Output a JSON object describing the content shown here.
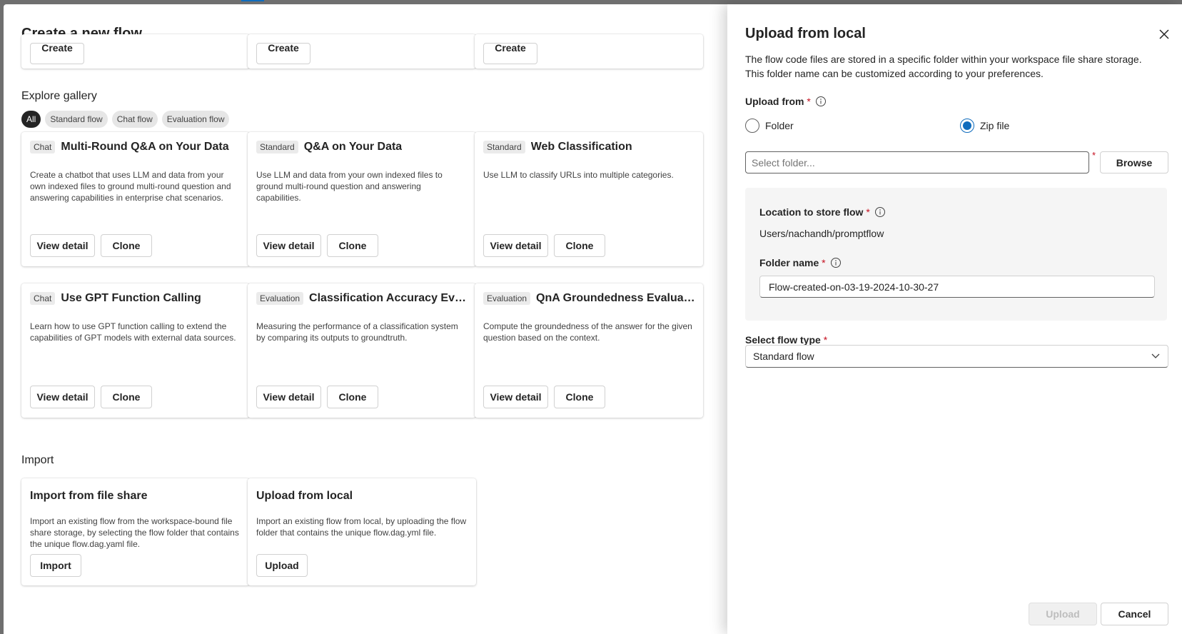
{
  "dialog": {
    "title": "Create a new flow",
    "top_row_buttons": [
      "Create",
      "Create",
      "Create"
    ]
  },
  "gallery": {
    "title": "Explore gallery",
    "filters": [
      "All",
      "Standard flow",
      "Chat flow",
      "Evaluation flow"
    ],
    "active_filter": "All",
    "cards": [
      {
        "tag": "Chat",
        "name": "Multi-Round Q&A on Your Data",
        "desc": "Create a chatbot that uses LLM and data from your own indexed files to ground multi-round question and answering capabilities in enterprise chat scenarios.",
        "view": "View detail",
        "clone": "Clone"
      },
      {
        "tag": "Standard",
        "name": "Q&A on Your Data",
        "desc": "Use LLM and data from your own indexed files to ground multi-round question and answering capabilities.",
        "view": "View detail",
        "clone": "Clone"
      },
      {
        "tag": "Standard",
        "name": "Web Classification",
        "desc": "Use LLM to classify URLs into multiple categories.",
        "view": "View detail",
        "clone": "Clone"
      },
      {
        "tag": "Chat",
        "name": "Use GPT Function Calling",
        "desc": "Learn how to use GPT function calling to extend the capabilities of GPT models with external data sources.",
        "view": "View detail",
        "clone": "Clone"
      },
      {
        "tag": "Evaluation",
        "name": "Classification Accuracy Evalu...",
        "desc": "Measuring the performance of a classification system by comparing its outputs to groundtruth.",
        "view": "View detail",
        "clone": "Clone"
      },
      {
        "tag": "Evaluation",
        "name": "QnA Groundedness Evaluation",
        "desc": "Compute the groundedness of the answer for the given question based on the context.",
        "view": "View detail",
        "clone": "Clone"
      }
    ]
  },
  "import": {
    "title": "Import",
    "cards": [
      {
        "name": "Import from file share",
        "desc": "Import an existing flow from the workspace-bound file share storage, by selecting the flow folder that contains the unique flow.dag.yaml file.",
        "button": "Import"
      },
      {
        "name": "Upload from local",
        "desc": "Import an existing flow from local, by uploading the flow folder that contains the unique flow.dag.yml file.",
        "button": "Upload"
      }
    ]
  },
  "panel": {
    "title": "Upload from local",
    "description": "The flow code files are stored in a specific folder within your workspace file share storage. This folder name can be customized according to your preferences.",
    "upload_from_label": "Upload from",
    "required_mark": "*",
    "options": [
      "Folder",
      "Zip file"
    ],
    "selected_option": "Zip file",
    "file_input_placeholder": "Select folder...",
    "browse_label": "Browse",
    "location_label": "Location to store flow",
    "location_value": "Users/nachandh/promptflow",
    "folder_name_label": "Folder name",
    "folder_name_value": "Flow-created-on-03-19-2024-10-30-27",
    "flow_type_label": "Select flow type",
    "flow_type_value": "Standard flow",
    "upload_button": "Upload",
    "cancel_button": "Cancel"
  }
}
